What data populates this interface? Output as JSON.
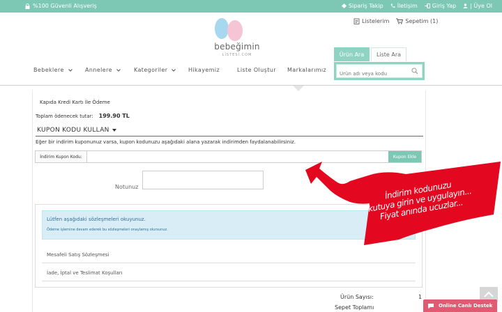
{
  "topbar": {
    "secure": "%100 Güvenli Alışveriş",
    "links": [
      "Sipariş Takip",
      "İletişim",
      "Giriş Yap",
      "| Üye Ol"
    ]
  },
  "header": {
    "logo_name": "bebeğimin",
    "logo_sub": "LİSTESİ.COM",
    "lists_link": "Listelerim",
    "cart_link": "Sepetim (1)",
    "tabs": [
      "Ürün Ara",
      "Liste Ara"
    ],
    "search_placeholder": "Ürün adı veya kodu"
  },
  "nav": {
    "items": [
      "Bebeklere",
      "Annelere",
      "Kategoriler",
      "Hikayemiz",
      "Liste Oluştur",
      "Markalarımız"
    ]
  },
  "checkout": {
    "payment_method": "Kapıda Kredi Kartı İle Ödeme",
    "total_label": "Toplam ödenecek tutar:",
    "total_value": "199.90 TL",
    "coupon_title": "KUPON KODU KULLAN",
    "coupon_desc": "Eğer bir indirim kuponunuz varsa, kupon kodunuzu aşağıdaki alana yazarak indirimden faydalanabilirsiniz.",
    "coupon_label": "İndirim Kupon Kodu:",
    "coupon_button": "Kupon Ekle",
    "note_label": "Notunuz",
    "alert_title": "Lütfen aşağıdaki sözleşmeleri okuyunuz.",
    "alert_desc": "Ödeme işlemine devam ederek bu sözleşmeleri onaylamış olursunuz.",
    "contracts": [
      "Mesafeli Satış Sözleşmesi",
      "İade, İptal ve Teslimat Koşulları"
    ],
    "product_count_label": "Ürün Sayısı:",
    "product_count": "1",
    "cart_total_label": "Sepet Toplamı"
  },
  "ribbon": {
    "lines": [
      "İndirim kodunuzu",
      "kutuya girin ve uygulayın...",
      "Fiyat anında ucuzlar..."
    ]
  },
  "live_support": "Online Canlı Destek",
  "colors": {
    "accent": "#7cc8b4",
    "ribbon": "#e3081f",
    "live": "#e05a72"
  }
}
